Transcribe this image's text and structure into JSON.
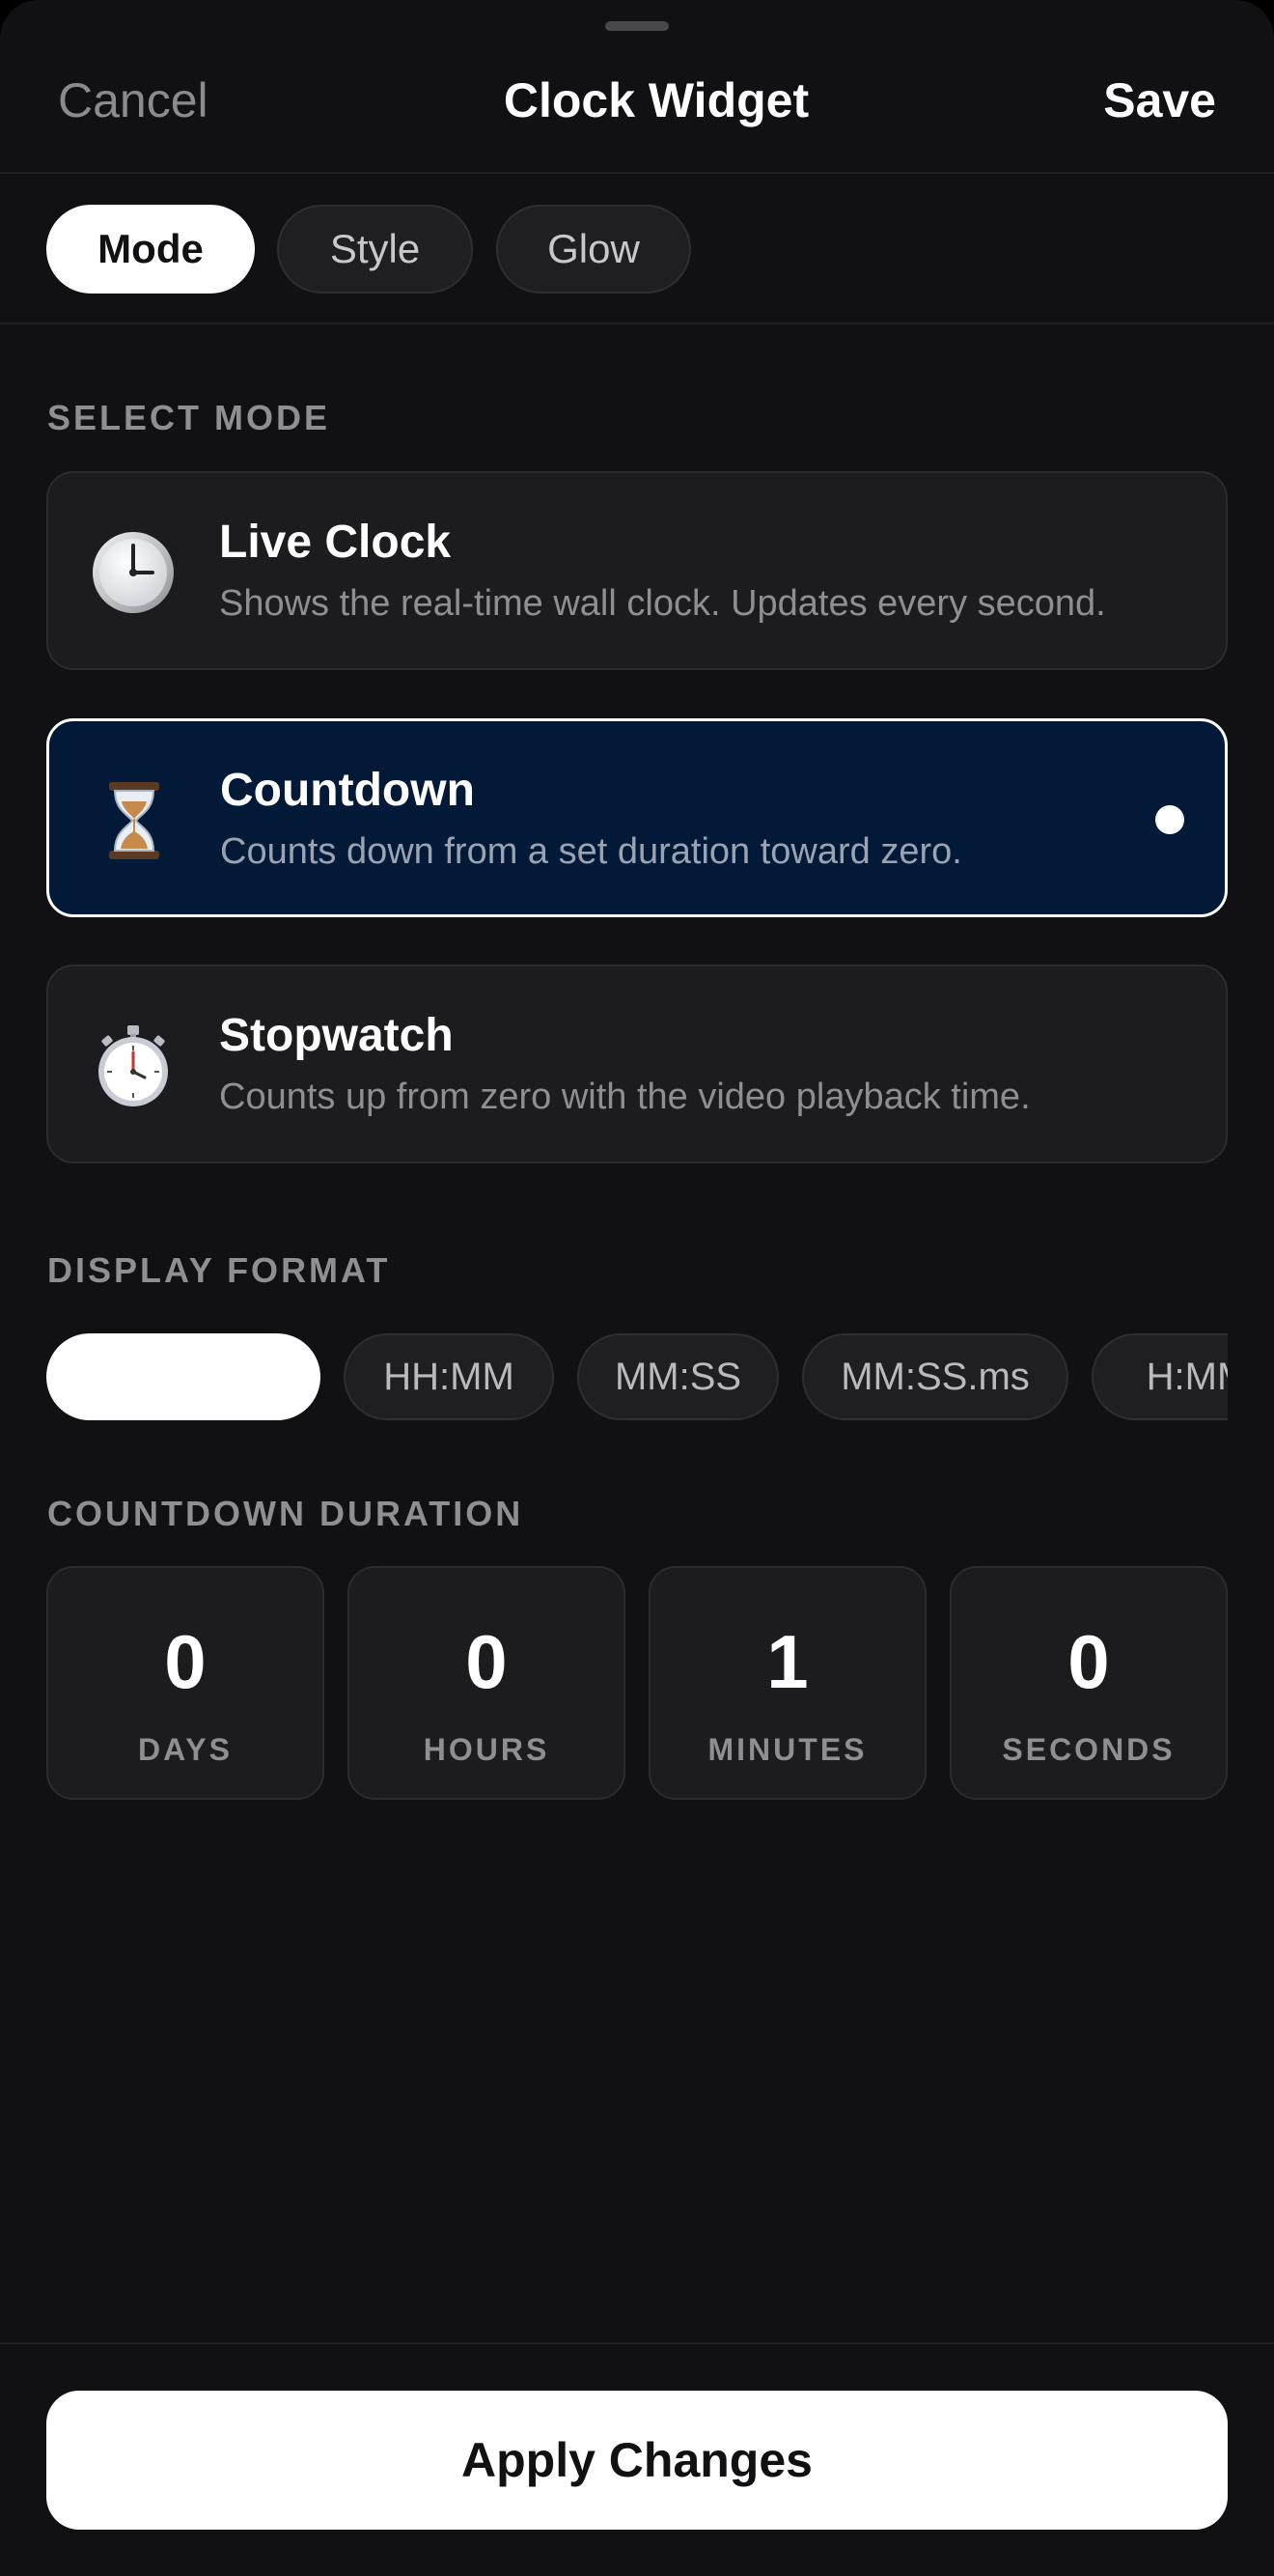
{
  "nav": {
    "cancel_label": "Cancel",
    "title": "Clock Widget",
    "save_label": "Save"
  },
  "tabs": [
    {
      "label": "Mode",
      "active": true
    },
    {
      "label": "Style",
      "active": false
    },
    {
      "label": "Glow",
      "active": false
    }
  ],
  "select_mode": {
    "heading": "SELECT MODE",
    "selected": "Countdown",
    "options": [
      {
        "icon": "clock-icon",
        "title": "Live Clock",
        "description": "Shows the real-time wall clock. Updates every second."
      },
      {
        "icon": "hourglass-icon",
        "title": "Countdown",
        "description": "Counts down from a set duration toward zero."
      },
      {
        "icon": "stopwatch-icon",
        "title": "Stopwatch",
        "description": "Counts up from zero with the video playback time."
      }
    ]
  },
  "display_format": {
    "heading": "DISPLAY FORMAT",
    "options": [
      {
        "label": "",
        "active": true
      },
      {
        "label": "HH:MM",
        "active": false
      },
      {
        "label": "MM:SS",
        "active": false
      },
      {
        "label": "MM:SS.ms",
        "active": false
      },
      {
        "label": "H:MM",
        "active": false
      }
    ]
  },
  "countdown_duration": {
    "heading": "COUNTDOWN DURATION",
    "fields": [
      {
        "value": "0",
        "label": "DAYS"
      },
      {
        "value": "0",
        "label": "HOURS"
      },
      {
        "value": "1",
        "label": "MINUTES"
      },
      {
        "value": "0",
        "label": "SECONDS"
      }
    ]
  },
  "footer": {
    "apply_label": "Apply Changes"
  },
  "colors": {
    "background": "#111113",
    "card": "#1c1c1f",
    "selected_card": "#021a38",
    "primary_text": "#ffffff",
    "secondary_text": "#8e8e93"
  }
}
